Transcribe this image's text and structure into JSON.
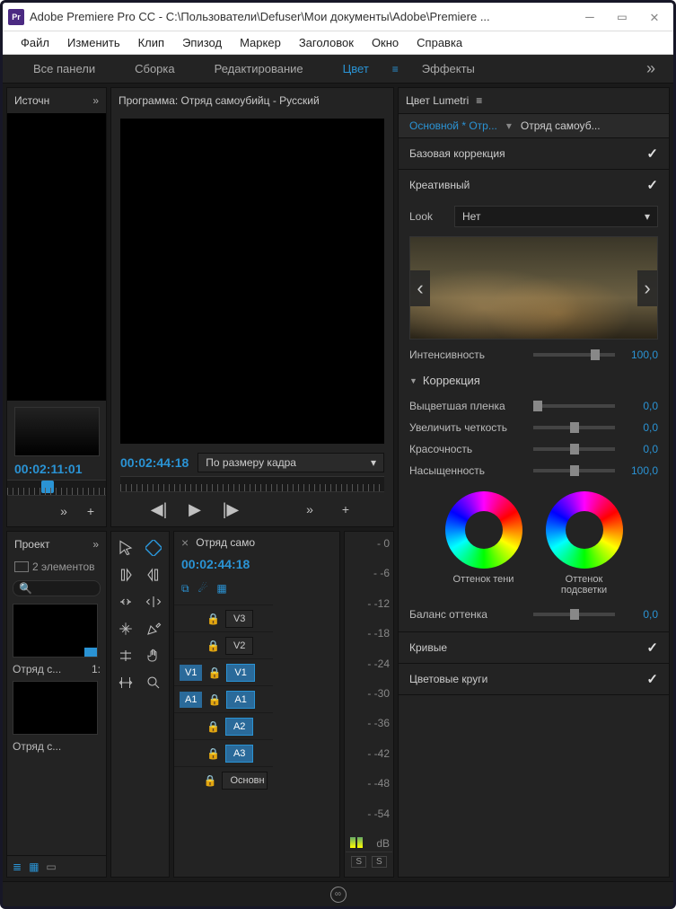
{
  "window": {
    "title": "Adobe Premiere Pro CC - C:\\Пользователи\\Defuser\\Мои документы\\Adobe\\Premiere ...",
    "app_abbrev": "Pr"
  },
  "menu": {
    "file": "Файл",
    "edit": "Изменить",
    "clip": "Клип",
    "sequence": "Эпизод",
    "marker": "Маркер",
    "title": "Заголовок",
    "window": "Окно",
    "help": "Справка"
  },
  "workspace": {
    "all": "Все панели",
    "assembly": "Сборка",
    "editing": "Редактирование",
    "color": "Цвет",
    "effects": "Эффекты",
    "expand": "»"
  },
  "source": {
    "title": "Источн",
    "expand": "»",
    "tc": "00:02:11:01",
    "ctrl_expand": "»",
    "ctrl_plus": "+"
  },
  "program": {
    "title": "Программа: Отряд самоубийц - Русский",
    "tc": "00:02:44:18",
    "fit": "По размеру кадра",
    "fit_arrow": "▾",
    "expand": "»",
    "plus": "+"
  },
  "project": {
    "title": "Проект",
    "expand": "»",
    "count": "2 элементов",
    "item1": "Отряд с...",
    "item1_dur": "1:",
    "item2": "Отряд с...",
    "item2_dur": ""
  },
  "timeline": {
    "close": "×",
    "title": "Отряд само",
    "tc": "00:02:44:18",
    "tracks": {
      "v3": "V3",
      "v2": "V2",
      "v1": "V1",
      "a1": "A1",
      "a2": "A2",
      "a3": "A3",
      "main": "Основн"
    },
    "src": {
      "v1": "V1",
      "a1": "A1"
    },
    "sync_s": "S",
    "db": "dB"
  },
  "meters": {
    "m0": "- 0",
    "m6": "- -6",
    "m12": "- -12",
    "m18": "- -18",
    "m24": "- -24",
    "m30": "- -30",
    "m36": "- -36",
    "m42": "- -42",
    "m48": "- -48",
    "m54": "- -54"
  },
  "lumetri": {
    "title": "Цвет Lumetri",
    "menu": "≡",
    "bc1": "Основной * Отр...",
    "bc_arrow": "▾",
    "bc2": "Отряд самоуб...",
    "basic": "Базовая коррекция",
    "check": "✓",
    "creative": "Креативный",
    "look_lbl": "Look",
    "look_val": "Нет",
    "look_arrow": "▾",
    "intensity": "Интенсивность",
    "intensity_val": "100,0",
    "adjust": "Коррекция",
    "faded": "Выцветшая пленка",
    "faded_val": "0,0",
    "sharpen": "Увеличить четкость",
    "sharpen_val": "0,0",
    "vibrance": "Красочность",
    "vibrance_val": "0,0",
    "saturation": "Насыщенность",
    "saturation_val": "100,0",
    "wheel_shadow": "Оттенок тени",
    "wheel_highlight": "Оттенок подсветки",
    "tint_balance": "Баланс оттенка",
    "tint_balance_val": "0,0",
    "curves": "Кривые",
    "wheels": "Цветовые круги"
  }
}
